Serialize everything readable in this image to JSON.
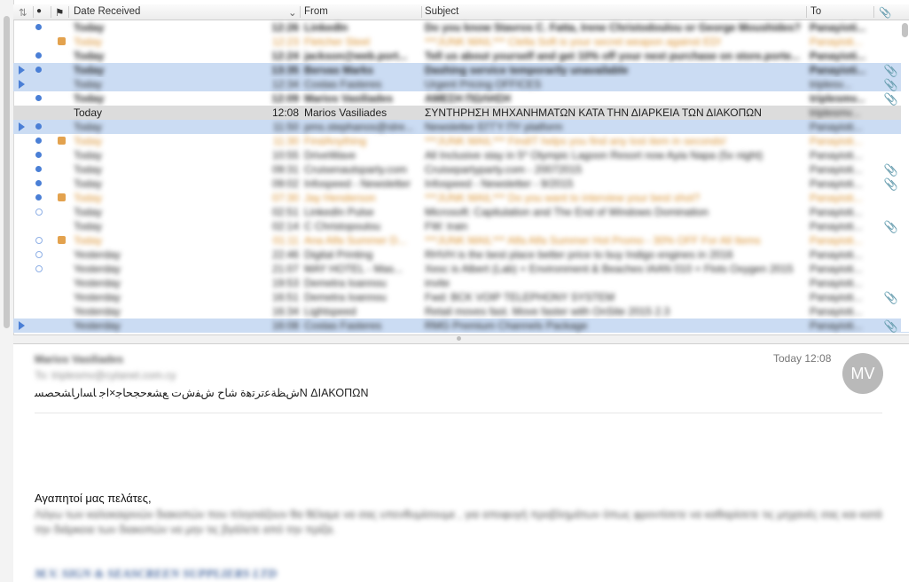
{
  "columns": {
    "date_received": "Date Received",
    "from": "From",
    "subject": "Subject",
    "to": "To"
  },
  "rows": [
    {
      "date": "Today",
      "time": "12:26",
      "from": "LinkedIn",
      "subject": "Do you know Stavros C. Fatta, Irene Christodoulou or George Moushides?",
      "to": "Panayioti...",
      "bold": true,
      "unread": "dot"
    },
    {
      "date": "Today",
      "time": "12:23",
      "from": "Fletcher Steel",
      "subject": "***JUNK MAIL*** Clella Soft is your secret weapon against ED!",
      "to": "Panayioti...",
      "bold": false,
      "orange": true,
      "flag": true
    },
    {
      "date": "Today",
      "time": "12:24",
      "from": "jackson@web.port...",
      "subject": "Tell us about yourself and get 10% off your next purchase on store.porte...",
      "to": "Panayioti...",
      "bold": true,
      "unread": "dot"
    },
    {
      "date": "Today",
      "time": "13:35",
      "from": "Bervas Marks",
      "subject": "Dashing service temporarily unavailable",
      "to": "Panayioti...",
      "bold": true,
      "unread": "dot",
      "selected": true,
      "thread": true,
      "attach": true
    },
    {
      "date": "Today",
      "time": "12:34",
      "from": "Costas Fasteres",
      "subject": "Urgent Pricing OFFICES",
      "to": "triplesv...",
      "bold": false,
      "selected": true,
      "thread": true,
      "attach": true
    },
    {
      "date": "Today",
      "time": "12:09",
      "from": "Marios Vasiliades",
      "subject": "ΑΜΕΣΗ ΠΩΛΗΣΗ",
      "to": "triplesmv...",
      "bold": true,
      "unread": "dot",
      "attach": true
    },
    {
      "date": "Today",
      "time": "12:08",
      "from": "Marios Vasiliades",
      "subject": "ΣΥΝΤΗΡΗΣΗ ΜΗΧΑΝΗΜΑΤΩΝ ΚΑΤΑ ΤΗΝ ΔΙΑΡΚΕΙΑ ΤΩΝ ΔΙΑΚΟΠΩΝ",
      "to": "triplesmv...",
      "bold": false,
      "current": true
    },
    {
      "date": "Today",
      "time": "11:50",
      "from": "pms.stephanos@stre...",
      "subject": "Newsletter ΕΓΓΥ ΠΥ platform",
      "to": "Panayioti...",
      "bold": false,
      "selected": true,
      "thread": true,
      "unread": "dot"
    },
    {
      "date": "Today",
      "time": "11:30",
      "from": "FindAnything",
      "subject": "***JUNK MAIL*** FindIT helps you find any lost item in seconds!",
      "to": "Panayioti...",
      "bold": false,
      "orange": true,
      "flag": true,
      "unread": "dot"
    },
    {
      "date": "Today",
      "time": "10:55",
      "from": "DriveWave",
      "subject": "All Inclusive stay in 5* Olympic Lagoon Resort now Ayia Napa (5x night)",
      "to": "Panayioti...",
      "bold": false,
      "unread": "dot"
    },
    {
      "date": "Today",
      "time": "09:31",
      "from": "Cruisenautsparty.com",
      "subject": "Cruisepartyparty.com - 20072015",
      "to": "Panayioti...",
      "bold": false,
      "unread": "dot",
      "attach": true
    },
    {
      "date": "Today",
      "time": "09:02",
      "from": "Infospeed - Newsletter",
      "subject": "Infospeed - Newsletter - 9/2015",
      "to": "Panayioti...",
      "bold": false,
      "unread": "dot",
      "attach": true
    },
    {
      "date": "Today",
      "time": "07:30",
      "from": "Jay Henderson",
      "subject": "***JUNK MAIL*** Do you want to interview your best shot?",
      "to": "Panayioti...",
      "bold": false,
      "orange": true,
      "flag": true,
      "unread": "dot"
    },
    {
      "date": "Today",
      "time": "02:51",
      "from": "LinkedIn Pulse",
      "subject": "Microsoft: Capitulation and The End of Windows Domination",
      "to": "Panayioti...",
      "bold": false,
      "unread": "light"
    },
    {
      "date": "Today",
      "time": "02:14",
      "from": "C Christopoulou",
      "subject": "FW: train",
      "to": "Panayioti...",
      "bold": false,
      "attach": true
    },
    {
      "date": "Today",
      "time": "01:11",
      "from": "Ana Alfa Summer D...",
      "subject": "***JUNK MAIL*** Alfa Alfa Summer Hot Promo - 30% OFF For All Items",
      "to": "Panayioti...",
      "bold": false,
      "orange": true,
      "flag": true,
      "unread": "light"
    },
    {
      "date": "Yesterday",
      "time": "22:46",
      "from": "Digital Printing",
      "subject": "RHVH is the best place better price to buy Indigo engines in 2016",
      "to": "Panayioti...",
      "bold": false,
      "unread": "light"
    },
    {
      "date": "Yesterday",
      "time": "21:07",
      "from": "MAY HOTEL - Mas...",
      "subject": "Xesc is Albert (Lab) + Environment & Beaches IAAN 010 + Flots Oxygen 2015",
      "to": "Panayioti...",
      "bold": false,
      "unread": "light"
    },
    {
      "date": "Yesterday",
      "time": "19:53",
      "from": "Demetra Ioannou",
      "subject": "invite",
      "to": "Panayioti...",
      "bold": false
    },
    {
      "date": "Yesterday",
      "time": "16:51",
      "from": "Demetra Ioannou",
      "subject": "Fwd: BCK VOIP TELEPHONY SYSTEM",
      "to": "Panayioti...",
      "bold": false,
      "attach": true
    },
    {
      "date": "Yesterday",
      "time": "16:34",
      "from": "Lightspeed",
      "subject": "Retail moves fast. Move faster with OnSite 2015 2.3",
      "to": "Panayioti...",
      "bold": false
    },
    {
      "date": "Yesterday",
      "time": "16:08",
      "from": "Costas Fasteres",
      "subject": "RMG Premium Channels Package",
      "to": "Panayioti...",
      "bold": false,
      "selected": true,
      "thread": true,
      "attach": true
    }
  ],
  "preview": {
    "from": "Marios Vasiliades",
    "to": "To: triplesmv@cytanet.com.cy",
    "date": "Today 12:08",
    "avatar": "MV",
    "subject": "ﺵﻈﺔﻋﺗﺮﺗﻫﺓ ﺷﺎﺡ ﺵﻔﺵﺕ ﻊﺸﻌﺣﺠﺤﺎﺟ×ﺍﺟ ﺎﺴﺍﺭﺎﺸﺤﺼﺴN ΔΙΑΚΟΠΩΝ",
    "greeting": "Αγαπητοί μας πελάτες,",
    "body": "Λόγω των καλοκαιρινών διακοπών που πλησιάζουν θα θέλαμε να σας υπενθυμίσουμε , για αποφυγή προβλημάτων όπως φροντίσετε να καθαρίσετε τις μηχανές σας και κατά την διάρκεια των διακοπών να μην τις βγάλετε από την πρίζα.",
    "company": "M.V. SIGN & SEASCREEN SUPPLIERS LTD"
  },
  "colors": {
    "selection": "#cbdcf3",
    "current": "#dcdcdc",
    "unread_dot": "#4a7fd6",
    "junk": "#d88f2c"
  }
}
